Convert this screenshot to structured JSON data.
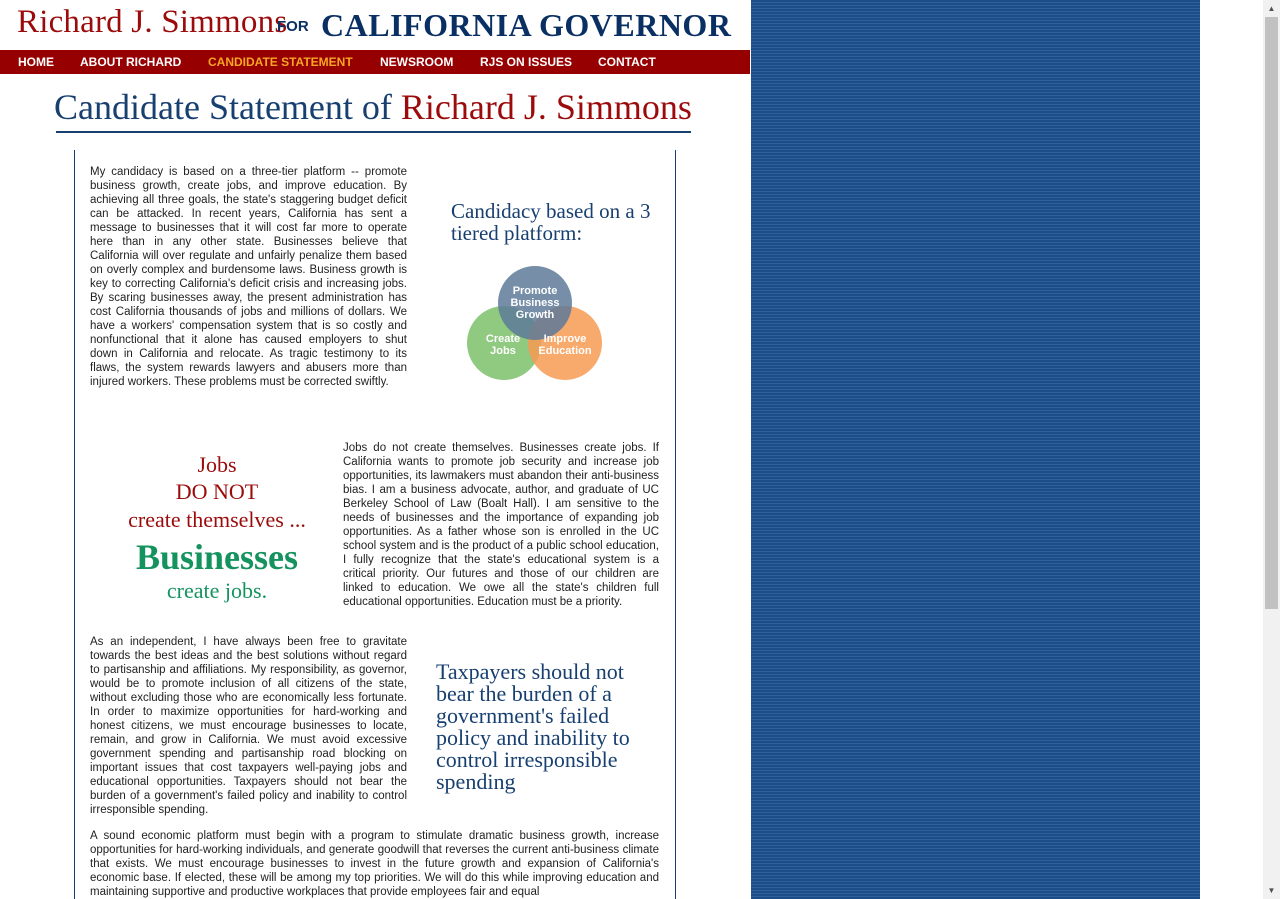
{
  "header": {
    "name": "Richard J. Simmons",
    "for": "FOR",
    "office": "CALIFORNIA GOVERNOR"
  },
  "nav": {
    "items": [
      {
        "label": "HOME"
      },
      {
        "label": "ABOUT RICHARD"
      },
      {
        "label": "CANDIDATE STATEMENT",
        "active": true
      },
      {
        "label": "NEWSROOM"
      },
      {
        "label": "RJS ON ISSUES"
      },
      {
        "label": "CONTACT"
      }
    ]
  },
  "page": {
    "title_prefix": "Candidate Statement of",
    "title_name": "Richard J. Simmons"
  },
  "content": {
    "paragraphs": [
      "My candidacy is based on a three-tier platform -- promote business growth, create jobs, and improve education. By achieving all three goals, the state's staggering budget deficit can be attacked. In recent years, California has sent a message to businesses that it will cost far more to operate here than in any other state. Businesses believe that California will over regulate and unfairly penalize them based on overly complex and burdensome laws. Business growth is key to correcting California's deficit crisis and increasing jobs. By scaring businesses away, the present administration has cost California thousands of jobs and millions of dollars. We have a workers' compensation system that is so costly and nonfunctional that it alone has caused employers to shut down in California and relocate. As tragic testimony to its flaws, the system rewards lawyers and abusers more than injured workers. These problems must be corrected swiftly.",
      "Jobs do not create themselves. Businesses create jobs. If California wants to promote job security and increase job opportunities, its lawmakers must abandon their anti-business bias. I am a business advocate, author, and graduate of UC Berkeley School of Law (Boalt Hall). I am sensitive to the needs of businesses and the importance of expanding job opportunities. As a father whose son is enrolled in the UC school system and is the product of a public school education, I fully recognize that the state's educational system is a critical priority. Our futures and those of our children are linked to education. We owe all the state's children full educational opportunities. Education must be a priority.",
      "As an independent, I have always been free to gravitate towards the best ideas and the best solutions without regard to partisanship and affiliations. My responsibility, as governor, would be to promote inclusion of all citizens of the state, without excluding those who are economically less fortunate. In order to maximize opportunities for hard-working and honest citizens, we must encourage businesses to locate, remain, and grow in California. We must avoid excessive government spending and partisanship road blocking on important issues that cost taxpayers well-paying jobs and educational opportunities. Taxpayers should not bear the burden of a government's failed policy and inability to control irresponsible spending.",
      "A sound economic platform must begin with a program to stimulate dramatic business growth, increase opportunities for hard-working individuals, and generate goodwill that reverses the current anti-business climate that exists. We must encourage businesses to invest in the future growth and expansion of California's economic base. If elected, these will be among my top priorities. We will do this while improving education and maintaining supportive and productive workplaces that provide employees fair and equal"
    ],
    "callout_platform": "Candidacy based on a 3 tiered platform:",
    "venn": {
      "top": [
        "Promote",
        "Business",
        "Growth"
      ],
      "left": [
        "Create",
        "Jobs"
      ],
      "right": [
        "Improve",
        "Education"
      ],
      "colors": {
        "top": "#5e7a99",
        "left": "#7dbf6a",
        "right": "#f79a52"
      }
    },
    "jobs_graphic": {
      "line1": "Jobs",
      "line2": "DO NOT",
      "line3": "create themselves ...",
      "line4": "Businesses",
      "line5": "create jobs."
    },
    "callout_tax": "Taxpayers should not bear the burden of a government's failed policy and inability to control irresponsible spending"
  },
  "colors": {
    "brand_red": "#9b0b0b",
    "brand_navy": "#0a2f63",
    "nav_bg": "#960000",
    "nav_active": "#f6a623",
    "business_green": "#15935f"
  }
}
